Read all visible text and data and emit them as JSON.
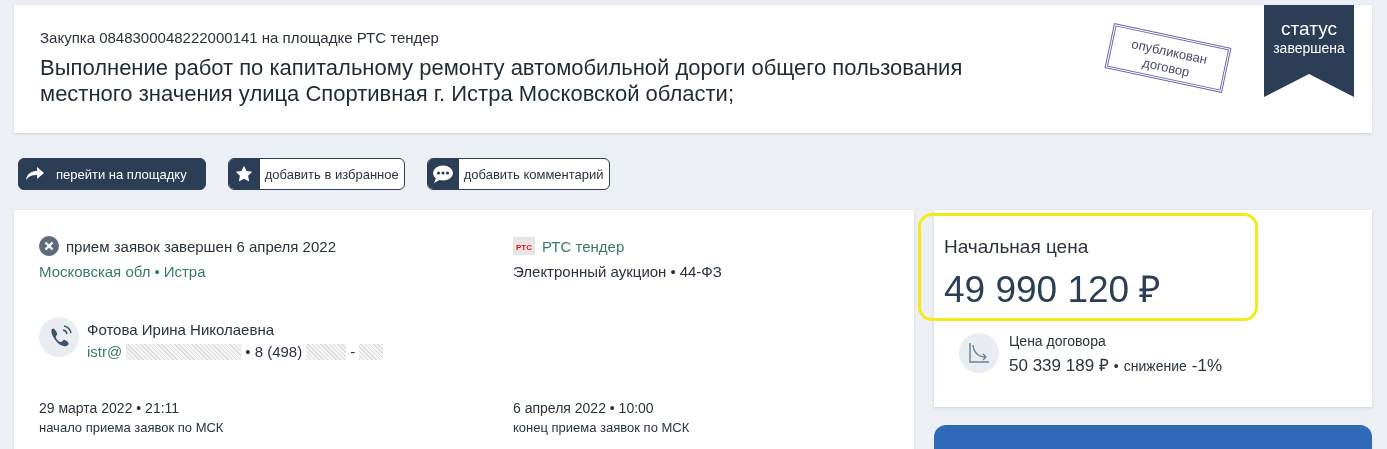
{
  "header": {
    "procurement": "Закупка 0848300048222000141 на площадке РТС тендер",
    "title": "Выполнение работ по капитальному ремонту автомобильной дороги общего пользования местного значения улица Спортивная г. Истра Московской области;",
    "stamp": "опубликован договор",
    "status_label": "статус",
    "status_value": "завершена"
  },
  "actions": [
    {
      "kind": "go",
      "label": "перейти на площадку"
    },
    {
      "kind": "favorite",
      "label": "добавить в избранное"
    },
    {
      "kind": "comment",
      "label": "добавить комментарий"
    }
  ],
  "details": {
    "deadline": "прием заявок завершен 6 апреля 2022",
    "region": "Московская обл",
    "city": "Истра",
    "separator": "•",
    "platform": "РТС тендер",
    "platform_logo": "РТС",
    "method": "Электронный аукцион",
    "law": "44-ФЗ",
    "contact_name": "Фотова Ирина Николаевна",
    "email_prefix": "istr@",
    "phone_prefix": "• 8 (498)",
    "phone_dash": "-",
    "dates": [
      {
        "value": "29 марта 2022 • 21:11",
        "caption": "начало приема заявок по МСК"
      },
      {
        "value": "6 апреля 2022 • 10:00",
        "caption": "конец приема заявок по МСК"
      }
    ]
  },
  "price": {
    "label": "Начальная цена",
    "value": "49 990 120 ₽",
    "contract_label": "Цена договора",
    "contract_value": "50 339 189 ₽",
    "reduction_label": "снижение",
    "reduction_value": "-1%"
  }
}
